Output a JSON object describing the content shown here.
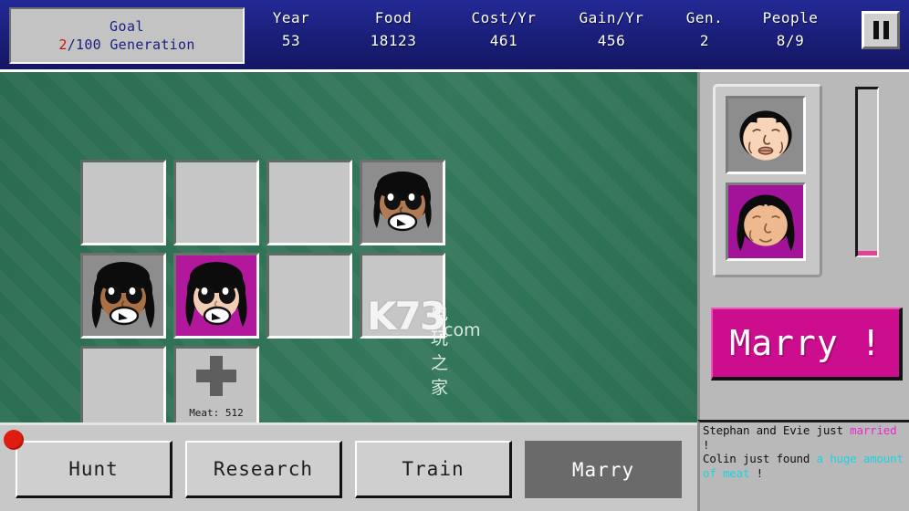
{
  "topbar": {
    "goal": {
      "title": "Goal",
      "current": "2",
      "rest": "/100 Generation"
    },
    "stats": [
      {
        "label": "Year",
        "value": "53"
      },
      {
        "label": "Food",
        "value": "18123"
      },
      {
        "label": "Cost/Yr",
        "value": "461"
      },
      {
        "label": "Gain/Yr",
        "value": "456"
      },
      {
        "label": "Gen.",
        "value": "2"
      },
      {
        "label": "People",
        "value": "8/9"
      }
    ],
    "pause_icon": "pause-icon"
  },
  "field": {
    "meat_slot": {
      "icon": "plus-icon",
      "label": "Meat: 512"
    },
    "watermark": {
      "main": "K73",
      "cn": "电玩之家",
      "domain": ".com"
    },
    "villagers": [
      {
        "slot": 4,
        "gender": "male",
        "skin": "#b07a55",
        "bg": "#8d8d8d"
      },
      {
        "slot": 5,
        "gender": "male",
        "skin": "#a87044",
        "bg": "#8d8d8d"
      },
      {
        "slot": 6,
        "gender": "female",
        "skin": "#f0cdb4",
        "bg": "#b2189b"
      }
    ]
  },
  "sidebar": {
    "male_portrait": {
      "name": "male-portrait",
      "bg": "#8d8d8d",
      "skin": "#f8d4b8"
    },
    "female_portrait": {
      "name": "female-portrait",
      "bg": "#a3139a",
      "skin": "#eeb98f"
    },
    "progress": {
      "name": "marry-progress-bar",
      "percent": 3,
      "color": "#e0429a"
    },
    "marry_button": "Marry !"
  },
  "log": {
    "lines": [
      {
        "parts": [
          {
            "t": "Stephan and Evie just ",
            "c": "plain"
          },
          {
            "t": "married",
            "c": "pink"
          },
          {
            "t": " !",
            "c": "plain"
          }
        ]
      },
      {
        "parts": [
          {
            "t": "Colin just found ",
            "c": "plain"
          },
          {
            "t": "a huge amount of  meat",
            "c": "cyan"
          },
          {
            "t": " !",
            "c": "plain"
          }
        ]
      }
    ]
  },
  "actions": {
    "buttons": [
      {
        "label": "Hunt",
        "active": false
      },
      {
        "label": "Research",
        "active": false
      },
      {
        "label": "Train",
        "active": false
      },
      {
        "label": "Marry",
        "active": true
      }
    ],
    "notification_dot": "#e01c10"
  },
  "colors": {
    "topbar_blue": "#1c2080",
    "field_green": "#2d7355",
    "accent_magenta": "#cc0e8e",
    "panel_gray": "#c6c6c6"
  }
}
